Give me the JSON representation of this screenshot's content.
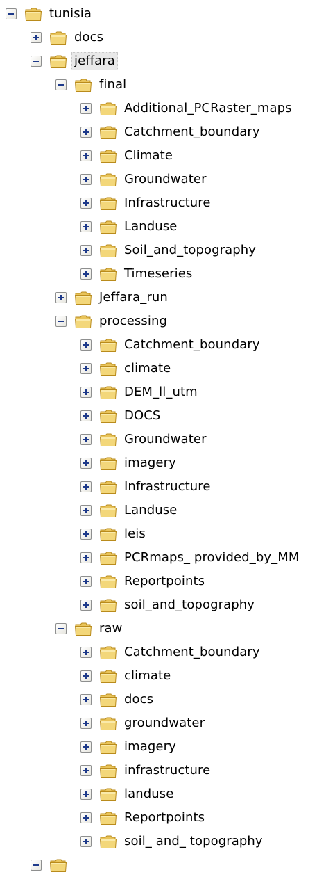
{
  "tree": {
    "rows": [
      {
        "label": "tunisia",
        "depth": 0,
        "expanded": true,
        "selected": false
      },
      {
        "label": "docs",
        "depth": 1,
        "expanded": false,
        "selected": false
      },
      {
        "label": "jeffara",
        "depth": 1,
        "expanded": true,
        "selected": true
      },
      {
        "label": "final",
        "depth": 2,
        "expanded": true,
        "selected": false
      },
      {
        "label": "Additional_PCRaster_maps",
        "depth": 3,
        "expanded": false,
        "selected": false
      },
      {
        "label": "Catchment_boundary",
        "depth": 3,
        "expanded": false,
        "selected": false
      },
      {
        "label": "Climate",
        "depth": 3,
        "expanded": false,
        "selected": false
      },
      {
        "label": "Groundwater",
        "depth": 3,
        "expanded": false,
        "selected": false
      },
      {
        "label": "Infrastructure",
        "depth": 3,
        "expanded": false,
        "selected": false
      },
      {
        "label": "Landuse",
        "depth": 3,
        "expanded": false,
        "selected": false
      },
      {
        "label": "Soil_and_topography",
        "depth": 3,
        "expanded": false,
        "selected": false
      },
      {
        "label": "Timeseries",
        "depth": 3,
        "expanded": false,
        "selected": false
      },
      {
        "label": "Jeffara_run",
        "depth": 2,
        "expanded": false,
        "selected": false
      },
      {
        "label": "processing",
        "depth": 2,
        "expanded": true,
        "selected": false
      },
      {
        "label": "Catchment_boundary",
        "depth": 3,
        "expanded": false,
        "selected": false
      },
      {
        "label": "climate",
        "depth": 3,
        "expanded": false,
        "selected": false
      },
      {
        "label": "DEM_ll_utm",
        "depth": 3,
        "expanded": false,
        "selected": false
      },
      {
        "label": "DOCS",
        "depth": 3,
        "expanded": false,
        "selected": false
      },
      {
        "label": "Groundwater",
        "depth": 3,
        "expanded": false,
        "selected": false
      },
      {
        "label": "imagery",
        "depth": 3,
        "expanded": false,
        "selected": false
      },
      {
        "label": "Infrastructure",
        "depth": 3,
        "expanded": false,
        "selected": false
      },
      {
        "label": "Landuse",
        "depth": 3,
        "expanded": false,
        "selected": false
      },
      {
        "label": "leis",
        "depth": 3,
        "expanded": false,
        "selected": false
      },
      {
        "label": "PCRmaps_ provided_by_MM",
        "depth": 3,
        "expanded": false,
        "selected": false
      },
      {
        "label": "Reportpoints",
        "depth": 3,
        "expanded": false,
        "selected": false
      },
      {
        "label": "soil_and_topography",
        "depth": 3,
        "expanded": false,
        "selected": false
      },
      {
        "label": "raw",
        "depth": 2,
        "expanded": true,
        "selected": false
      },
      {
        "label": "Catchment_boundary",
        "depth": 3,
        "expanded": false,
        "selected": false
      },
      {
        "label": "climate",
        "depth": 3,
        "expanded": false,
        "selected": false
      },
      {
        "label": "docs",
        "depth": 3,
        "expanded": false,
        "selected": false
      },
      {
        "label": "groundwater",
        "depth": 3,
        "expanded": false,
        "selected": false
      },
      {
        "label": "imagery",
        "depth": 3,
        "expanded": false,
        "selected": false
      },
      {
        "label": "infrastructure",
        "depth": 3,
        "expanded": false,
        "selected": false
      },
      {
        "label": "landuse",
        "depth": 3,
        "expanded": false,
        "selected": false
      },
      {
        "label": "Reportpoints",
        "depth": 3,
        "expanded": false,
        "selected": false
      },
      {
        "label": "soil_ and_ topography",
        "depth": 3,
        "expanded": false,
        "selected": false
      },
      {
        "label": "",
        "depth": 1,
        "expanded": true,
        "selected": false
      }
    ]
  },
  "colors": {
    "folder_body": "#f3d77a",
    "folder_tab": "#e9c45a",
    "folder_outline": "#b98b1c",
    "toggle_sign": "#1e3a8a",
    "toggle_border": "#8e8f8f",
    "selection_bg": "#e9e9e9"
  },
  "icons": {
    "folder": "folder-icon",
    "expand": "expand-plus-icon",
    "collapse": "collapse-minus-icon"
  }
}
